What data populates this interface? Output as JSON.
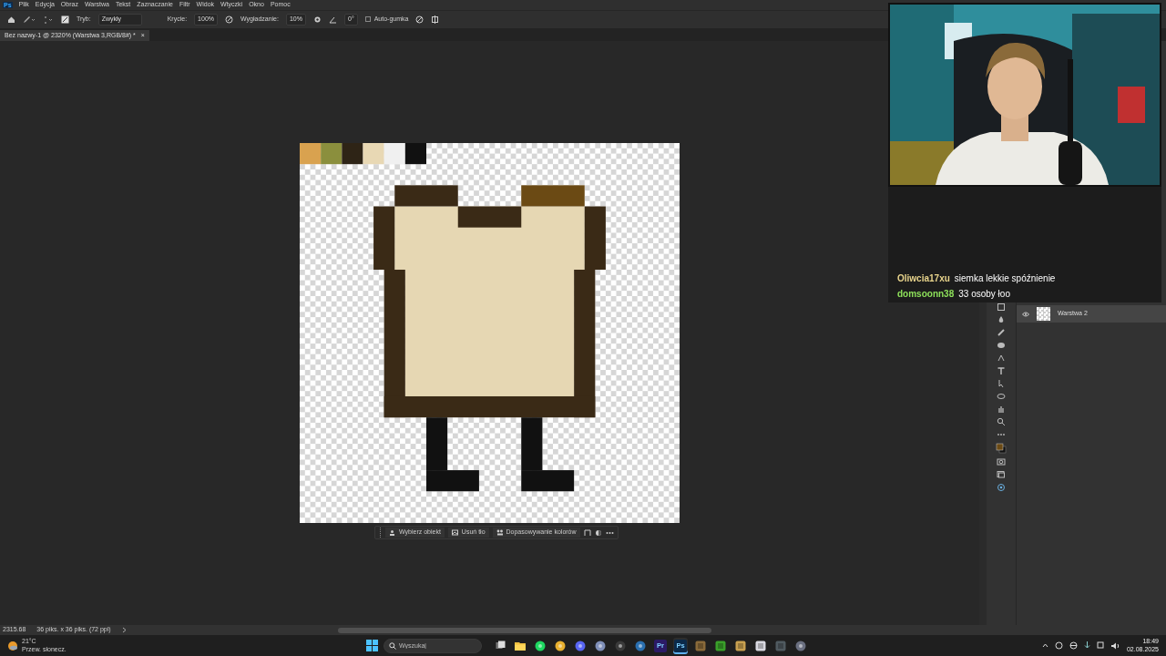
{
  "app": {
    "logo": "Ps",
    "menu": [
      "Plik",
      "Edycja",
      "Obraz",
      "Warstwa",
      "Tekst",
      "Zaznaczanie",
      "Filtr",
      "Widok",
      "Wtyczki",
      "Okno",
      "Pomoc"
    ]
  },
  "options_bar": {
    "mode_label": "Tryb:",
    "mode": "Zwykły",
    "opacity_label": "Krycie:",
    "opacity": "100%",
    "smoothing_label": "Wygładzanie:",
    "smoothing": "10%",
    "angle": "0°",
    "auto_erase": {
      "label": "Auto-gumka",
      "checked": false
    }
  },
  "document_tab": {
    "title": "Bez nazwy-1 @ 2320% (Warstwa 3,RGB/8#) *",
    "close": "×"
  },
  "context_bar": {
    "buttons": [
      "Wybierz obiekt",
      "Usuń tło",
      "Dopasowywanie kolorów"
    ]
  },
  "layers": [
    {
      "name": "Warstwa 2",
      "visible": true,
      "selected": true
    }
  ],
  "stream": {
    "chat": [
      {
        "user": "Oliwcia17xu",
        "color": "#e8d48c",
        "message": "siemka lekkie spóźnienie"
      },
      {
        "user": "domsoonn38",
        "color": "#8de05a",
        "message": "33 osoby łoo"
      }
    ]
  },
  "status_bar": {
    "zoom": "2315.68",
    "size": "36 piks. x 36 piks. (72 ppi)"
  },
  "taskbar": {
    "weather": {
      "temp": "21°C",
      "desc": "Przew. słonecz."
    },
    "search": {
      "placeholder": "Wyszukaj"
    },
    "apps": [
      {
        "kind": "taskview",
        "active": false
      },
      {
        "kind": "folder",
        "active": false
      },
      {
        "kind": "round",
        "color": "#1ed760",
        "active": false
      },
      {
        "kind": "round",
        "color": "#e8b030",
        "active": false
      },
      {
        "kind": "round",
        "color": "#5865f2",
        "active": false
      },
      {
        "kind": "round",
        "color": "#7f8fb8",
        "active": false
      },
      {
        "kind": "round",
        "color": "#3a3a3a",
        "active": false
      },
      {
        "kind": "round",
        "color": "#2a6fb0",
        "active": false
      },
      {
        "kind": "tile",
        "color": "#2b1a66",
        "label": "Pr",
        "active": false
      },
      {
        "kind": "tile",
        "color": "#0b2a4a",
        "label": "Ps",
        "active": true
      },
      {
        "kind": "tile",
        "color": "#8a6a3a",
        "active": false
      },
      {
        "kind": "tile",
        "color": "#3aa02a",
        "active": false
      },
      {
        "kind": "tile",
        "color": "#c8a050",
        "active": false
      },
      {
        "kind": "tile",
        "color": "#d8d8e0",
        "active": false
      },
      {
        "kind": "tile",
        "color": "#505a60",
        "active": false
      },
      {
        "kind": "round",
        "color": "#6a6f80",
        "active": false
      }
    ],
    "clock": {
      "time": "18:49",
      "date": "02.08.2025"
    }
  }
}
